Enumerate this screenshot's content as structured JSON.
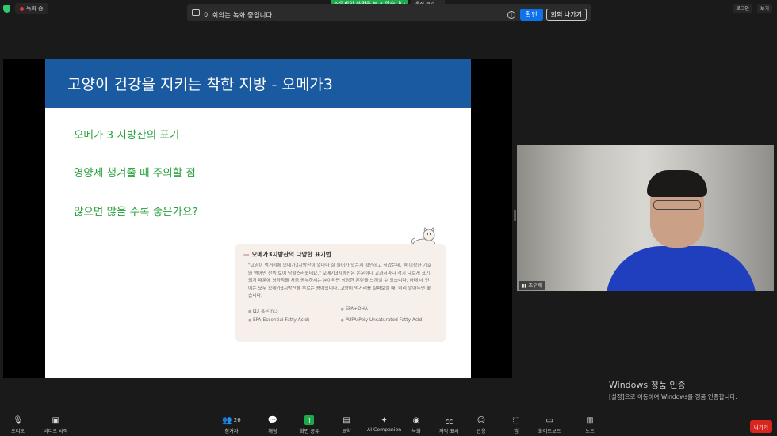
{
  "top": {
    "recording_label": "녹화 중",
    "share_notice": "조우제의 화면을 보고 있습니다",
    "view_options": "옵션 보기",
    "banner_message": "이 회의는 녹화 중입니다.",
    "confirm": "확인",
    "leave_meeting": "회의 나가기",
    "right_items": [
      "로그인",
      "보기"
    ]
  },
  "slide": {
    "title": "고양이 건강을 지키는 착한 지방 - 오메가3",
    "items": [
      "오메가 3 지방산의 표기",
      "영양제 챙겨줄 때 주의할 점",
      "많으면 많을 수록 좋은가요?"
    ],
    "card": {
      "title": "오메가3지방산의 다양한 표기법",
      "body": "\"고양이 먹거리에 오메가3지방산이 얼마나 잘 들어가 있는지 확인하고 싶었는데, 웬 이상한 기호와 영어만 잔뜩 보여 당황스러웠네요.\" 오메가3지방산은 논문이나 교과서마다 각기 다르게 표기되기 때문에 영양학을 처음 공부하시는 분이라면 상당한 혼란을 느끼실 수 있습니다. 아래 네 단어는 모두 오메가3지방산을 부르는 용어입니다. 고양이 먹거리를 살펴보실 때, 미리 알아두면 좋습니다.",
      "terms": [
        "Ω3 혹은 n:3",
        "EPA+DHA",
        "EFA(Essential Fatty Acid)",
        "PUFA(Poly Unsaturated Fatty Acid)"
      ]
    }
  },
  "video": {
    "name": "조우제"
  },
  "watermark": {
    "line1": "Windows 정품 인증",
    "line2": "[설정]으로 이동하여 Windows를 정품 인증합니다."
  },
  "toolbar": {
    "audio": "오디오",
    "video": "비디오 시작",
    "participants": "참가자",
    "participants_count": "26",
    "chat": "채팅",
    "share": "화면 공유",
    "summary": "요약",
    "ai": "AI Companion",
    "record": "녹화",
    "captions": "자막 표시",
    "reactions": "반응",
    "apps": "앱",
    "whiteboard": "화이트보드",
    "notes": "노트",
    "leave": "나가기"
  }
}
